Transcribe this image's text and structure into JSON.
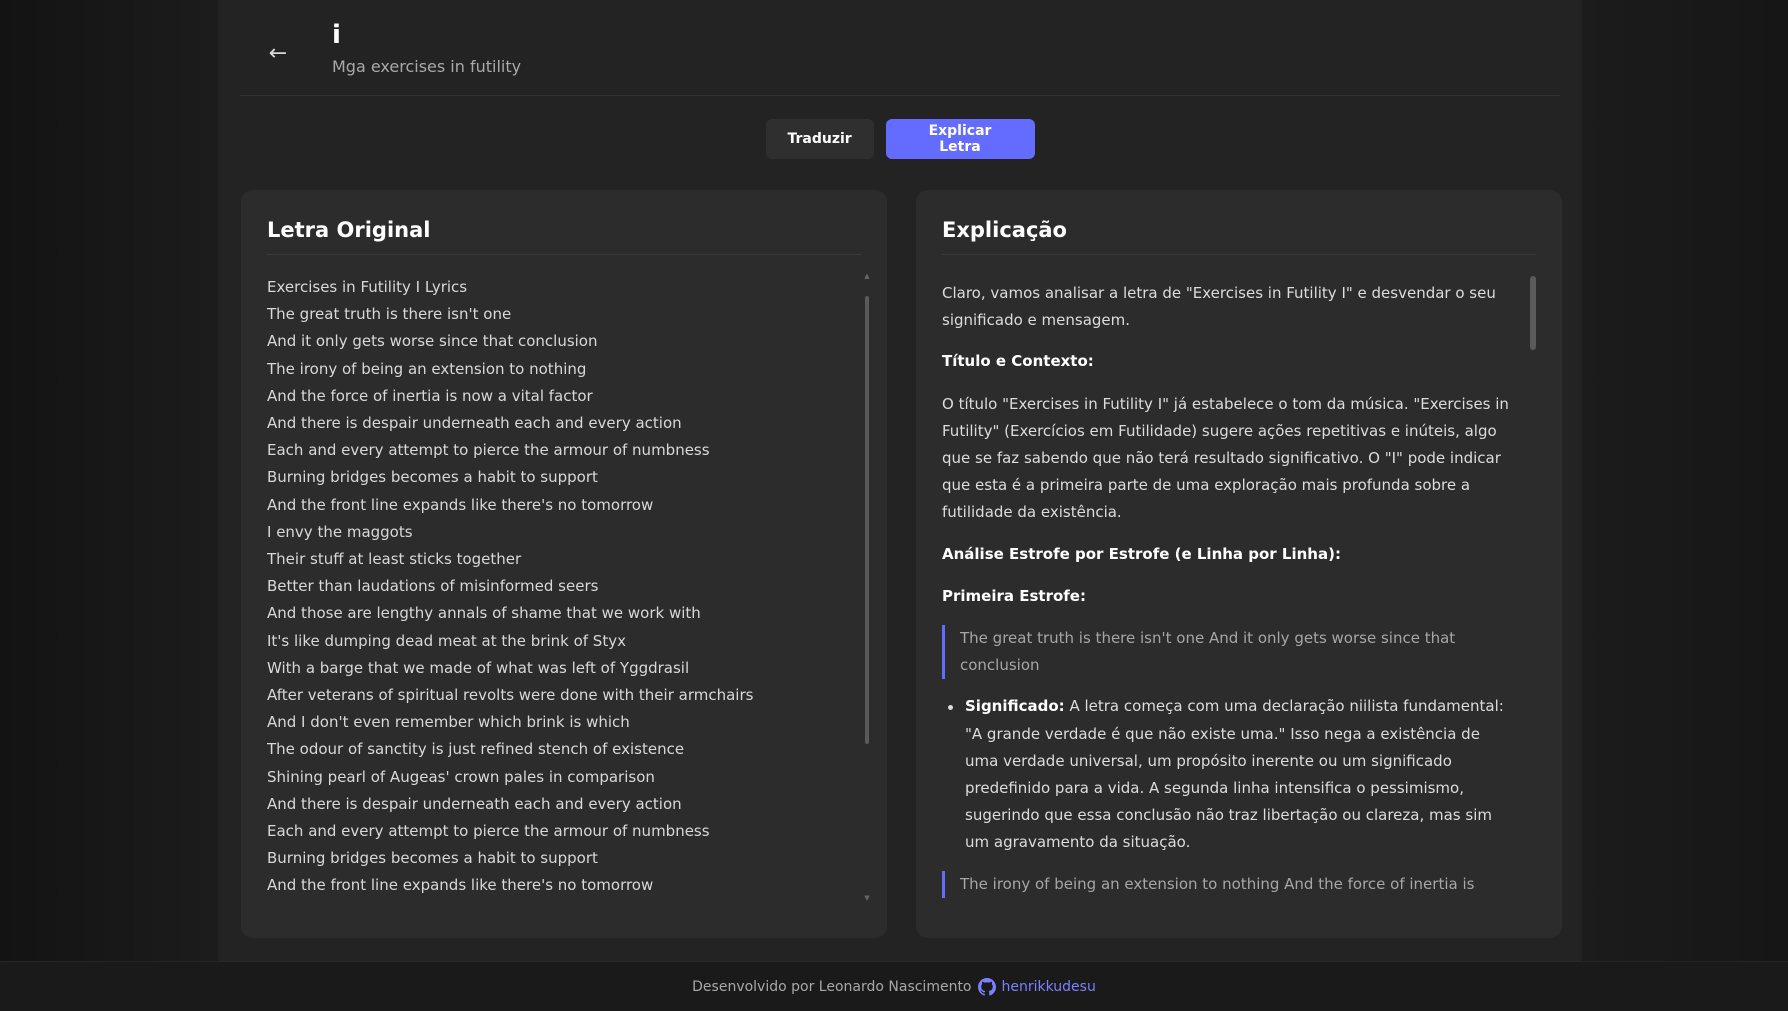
{
  "header": {
    "back_icon": "←",
    "title": "i",
    "artist": "Mga exercises in futility"
  },
  "actions": {
    "translate_label": "Traduzir",
    "explain_label": "Explicar Letra"
  },
  "original": {
    "title": "Letra Original",
    "lines": [
      "Exercises in Futility I Lyrics",
      "The great truth is there isn't one",
      "And it only gets worse since that conclusion",
      "The irony of being an extension to nothing",
      "And the force of inertia is now a vital factor",
      "And there is despair underneath each and every action",
      "Each and every attempt to pierce the armour of numbness",
      "Burning bridges becomes a habit to support",
      "And the front line expands like there's no tomorrow",
      "I envy the maggots",
      "Their stuff at least sticks together",
      "Better than laudations of misinformed seers",
      "And those are lengthy annals of shame that we work with",
      "It's like dumping dead meat at the brink of Styx",
      "With a barge that we made of what was left of Yggdrasil",
      "After veterans of spiritual revolts were done with their armchairs",
      "And I don't even remember which brink is which",
      "The odour of sanctity is just refined stench of existence",
      "Shining pearl of Augeas' crown pales in comparison",
      "And there is despair underneath each and every action",
      "Each and every attempt to pierce the armour of numbness",
      "Burning bridges becomes a habit to support",
      "And the front line expands like there's no tomorrow"
    ]
  },
  "explanation": {
    "title": "Explicação",
    "intro": "Claro, vamos analisar a letra de \"Exercises in Futility I\" e desvendar o seu significado e mensagem.",
    "context_heading": "Título e Contexto:",
    "context_text": "O título \"Exercises in Futility I\" já estabelece o tom da música. \"Exercises in Futility\" (Exercícios em Futilidade) sugere ações repetitivas e inúteis, algo que se faz sabendo que não terá resultado significativo. O \"I\" pode indicar que esta é a primeira parte de uma exploração mais profunda sobre a futilidade da existência.",
    "analysis_heading": "Análise Estrofe por Estrofe (e Linha por Linha):",
    "first_stanza_heading": "Primeira Estrofe:",
    "quote1": "The great truth is there isn't one And it only gets worse since that conclusion",
    "meaning_label": "Significado:",
    "meaning_text": " A letra começa com uma declaração niilista fundamental: \"A grande verdade é que não existe uma.\" Isso nega a existência de uma verdade universal, um propósito inerente ou um significado predefinido para a vida. A segunda linha intensifica o pessimismo, sugerindo que essa conclusão não traz libertação ou clareza, mas sim um agravamento da situação.",
    "quote2": "The irony of being an extension to nothing And the force of inertia is"
  },
  "footer": {
    "text": "Desenvolvido por Leonardo Nascimento",
    "github_icon": "github-icon",
    "link_label": "henrikkudesu"
  },
  "colors": {
    "accent": "#646cff",
    "background": "#1c1c1c",
    "card": "#2c2c2c"
  }
}
